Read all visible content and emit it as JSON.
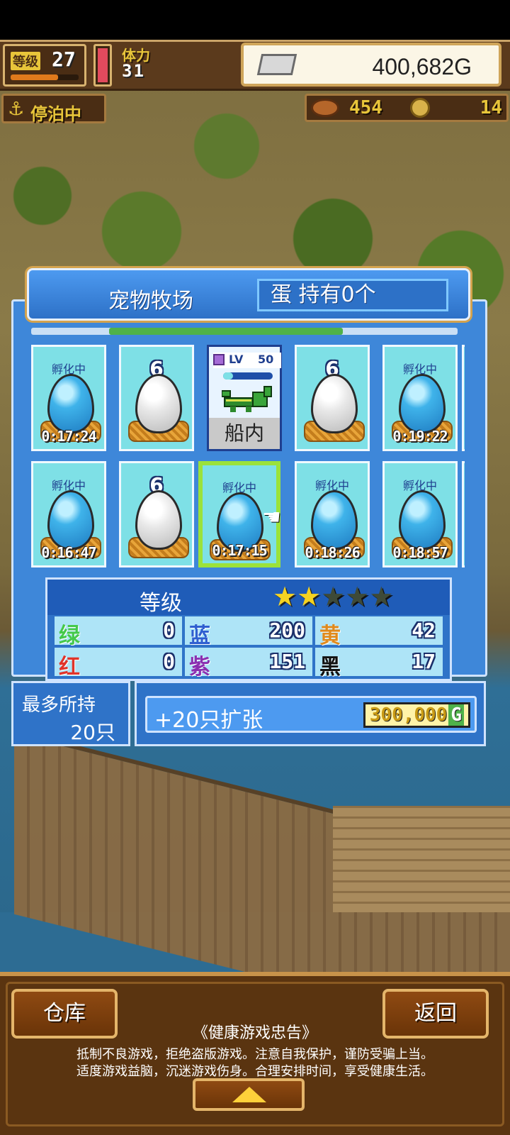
{
  "hud": {
    "level_label": "等级",
    "level": "27",
    "stamina_label": "体力",
    "stamina": "31",
    "gold": "400,682G",
    "status": "停泊中",
    "food": "454",
    "medals": "14"
  },
  "ranch": {
    "title": "宠物牧场",
    "egg_count": "蛋 持有0个",
    "slots_row1": [
      {
        "label": "孵化中",
        "timer": "0:17:24"
      },
      {
        "label": "6"
      },
      {
        "pet_lv_label": "LV",
        "pet_lv": "50",
        "status": "船内"
      },
      {
        "label": "6"
      },
      {
        "label": "孵化中",
        "timer": "0:19:22"
      }
    ],
    "slots_row2": [
      {
        "label": "孵化中",
        "timer": "0:16:47"
      },
      {
        "label": "6"
      },
      {
        "label": "孵化中",
        "timer": "0:17:15"
      },
      {
        "label": "孵化中",
        "timer": "0:18:26"
      },
      {
        "label": "孵化中",
        "timer": "0:18:57"
      }
    ]
  },
  "stats": {
    "title": "等级",
    "stars_filled": 2,
    "stars_total": 5,
    "green_label": "绿",
    "green": "0",
    "blue_label": "蓝",
    "blue": "200",
    "yellow_label": "黄",
    "yellow": "42",
    "red_label": "红",
    "red": "0",
    "purple_label": "紫",
    "purple": "151",
    "black_label": "黑",
    "black": "17"
  },
  "capacity": {
    "max_label": "最多所持",
    "max_value": "20只",
    "expand_label": "+20只扩张",
    "expand_price": "300,000",
    "currency": "G"
  },
  "footer": {
    "warehouse": "仓库",
    "back": "返回",
    "notice_title": "《健康游戏忠告》",
    "notice_line1": "抵制不良游戏，拒绝盗版游戏。注意自我保护，谨防受骗上当。",
    "notice_line2": "适度游戏益脑，沉迷游戏伤身。合理安排时间，享受健康生活。"
  },
  "colors": {
    "panel_blue": "#3e87d9",
    "egg_blue": "#3fb3ea",
    "select_green": "#9be23a",
    "gold_text": "#e8c53a"
  }
}
